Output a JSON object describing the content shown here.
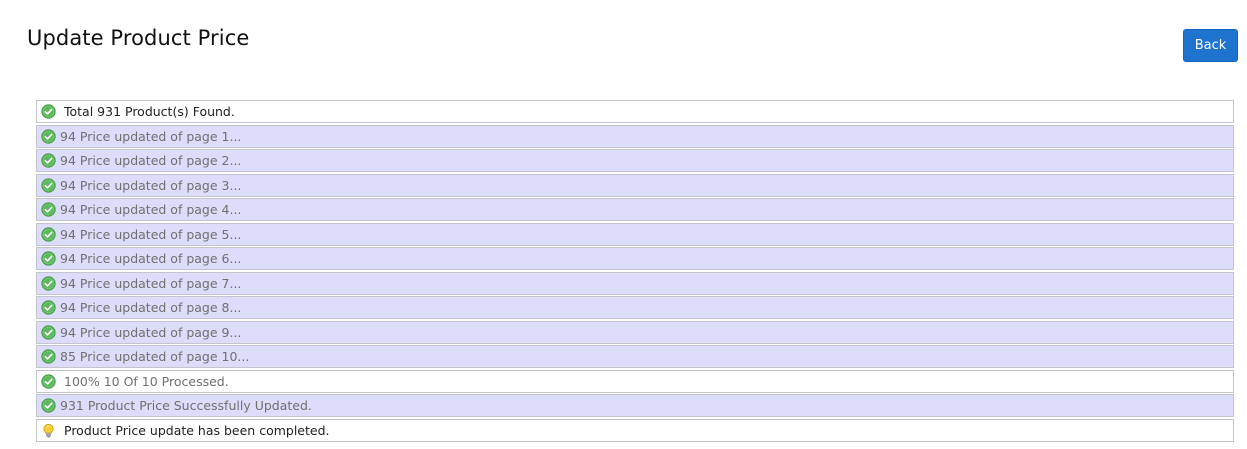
{
  "page": {
    "title": "Update Product Price",
    "back_label": "Back"
  },
  "colors": {
    "accent": "#1e73cf",
    "highlight_row": "#dcdcfb",
    "success_icon": "#5cb85c",
    "info_icon": "#f0c020"
  },
  "log": [
    {
      "text": "Total 931 Product(s) Found.",
      "icon": "check-circle-icon",
      "style": "plain"
    },
    {
      "text": "94 Price updated of page 1...",
      "icon": "check-circle-icon",
      "style": "highlight"
    },
    {
      "text": "94 Price updated of page 2...",
      "icon": "check-circle-icon",
      "style": "highlight"
    },
    {
      "text": "94 Price updated of page 3...",
      "icon": "check-circle-icon",
      "style": "highlight"
    },
    {
      "text": "94 Price updated of page 4...",
      "icon": "check-circle-icon",
      "style": "highlight"
    },
    {
      "text": "94 Price updated of page 5...",
      "icon": "check-circle-icon",
      "style": "highlight"
    },
    {
      "text": "94 Price updated of page 6...",
      "icon": "check-circle-icon",
      "style": "highlight"
    },
    {
      "text": "94 Price updated of page 7...",
      "icon": "check-circle-icon",
      "style": "highlight"
    },
    {
      "text": "94 Price updated of page 8...",
      "icon": "check-circle-icon",
      "style": "highlight"
    },
    {
      "text": "94 Price updated of page 9...",
      "icon": "check-circle-icon",
      "style": "highlight"
    },
    {
      "text": "85 Price updated of page 10...",
      "icon": "check-circle-icon",
      "style": "highlight"
    },
    {
      "text": "100% 10 Of 10 Processed.",
      "icon": "check-circle-icon",
      "style": "plain muted"
    },
    {
      "text": "931 Product Price Successfully Updated.",
      "icon": "check-circle-icon",
      "style": "highlight"
    },
    {
      "text": "Product Price update has been completed.",
      "icon": "lightbulb-icon",
      "style": "plain"
    }
  ]
}
